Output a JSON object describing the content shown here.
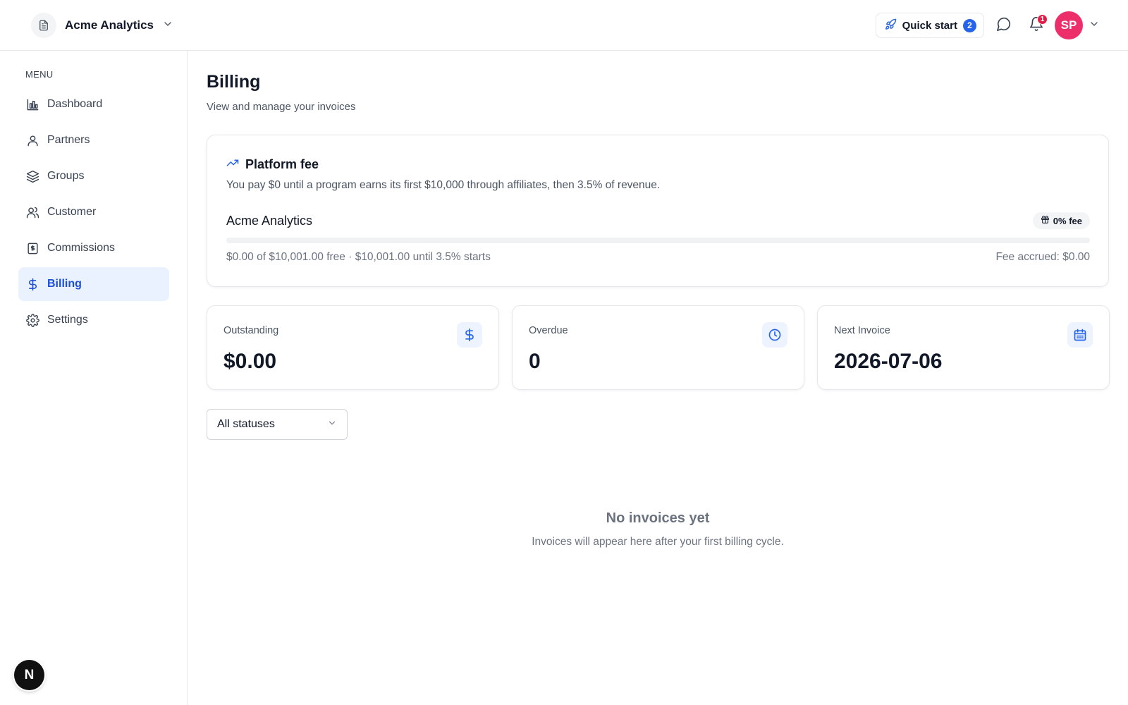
{
  "header": {
    "workspace_name": "Acme Analytics",
    "quick_start_label": "Quick start",
    "quick_start_count": "2",
    "notification_count": "1",
    "user_initials": "SP"
  },
  "sidebar": {
    "menu_title": "MENU",
    "items": [
      {
        "label": "Dashboard",
        "icon": "bar-chart-icon"
      },
      {
        "label": "Partners",
        "icon": "user-icon"
      },
      {
        "label": "Groups",
        "icon": "layers-icon"
      },
      {
        "label": "Customer",
        "icon": "users-icon"
      },
      {
        "label": "Commissions",
        "icon": "receipt-icon"
      },
      {
        "label": "Billing",
        "icon": "dollar-icon",
        "active": true
      },
      {
        "label": "Settings",
        "icon": "gear-icon"
      }
    ],
    "dev_badge": "N"
  },
  "page": {
    "title": "Billing",
    "subtitle": "View and manage your invoices"
  },
  "platform_fee": {
    "title": "Platform fee",
    "description": "You pay $0 until a program earns its first $10,000 through affiliates, then 3.5% of revenue.",
    "program_name": "Acme Analytics",
    "fee_pill": "0% fee",
    "progress_fraction": 0,
    "progress_text": "$0.00 of $10,001.00 free · $10,001.00 until 3.5% starts",
    "fee_accrued": "Fee accrued: $0.00"
  },
  "stats": [
    {
      "label": "Outstanding",
      "value": "$0.00",
      "icon": "dollar-icon"
    },
    {
      "label": "Overdue",
      "value": "0",
      "icon": "clock-icon"
    },
    {
      "label": "Next Invoice",
      "value": "2026-07-06",
      "icon": "calendar-icon"
    }
  ],
  "filter": {
    "selected": "All statuses"
  },
  "empty_state": {
    "title": "No invoices yet",
    "subtitle": "Invoices will appear here after your first billing cycle."
  },
  "colors": {
    "accent": "#2563eb",
    "active_bg": "#eaf2ff",
    "avatar": "#ec2f6b",
    "badge_red": "#e11d48"
  }
}
